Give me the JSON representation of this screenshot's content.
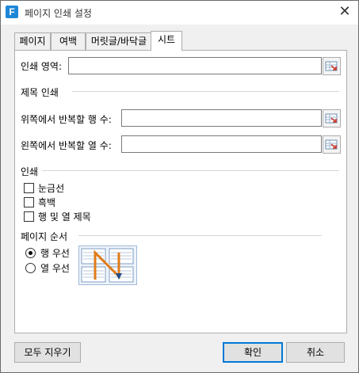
{
  "window": {
    "title": "페이지 인쇄 설정",
    "app_icon_letter": "F",
    "close_glyph": "✕"
  },
  "tabs": [
    {
      "label": "페이지",
      "active": false
    },
    {
      "label": "여백",
      "active": false
    },
    {
      "label": "머릿글/바닥글",
      "active": false
    },
    {
      "label": "시트",
      "active": true
    }
  ],
  "sheet": {
    "print_area_label": "인쇄 영역:",
    "print_area_value": "",
    "print_titles_heading": "제목 인쇄",
    "rows_repeat_label": "위쪽에서 반복할 행 수:",
    "rows_repeat_value": "",
    "cols_repeat_label": "왼쪽에서 반복할 열 수:",
    "cols_repeat_value": "",
    "print_heading": "인쇄",
    "options": [
      {
        "label": "눈금선",
        "checked": false
      },
      {
        "label": "흑백",
        "checked": false
      },
      {
        "label": "행 및 열 제목",
        "checked": false
      }
    ],
    "page_order_heading": "페이지 순서",
    "page_order": [
      {
        "label": "행 우선",
        "selected": true
      },
      {
        "label": "열 우선",
        "selected": false
      }
    ]
  },
  "buttons": {
    "clear_all": "모두 지우기",
    "ok": "확인",
    "cancel": "취소"
  },
  "colors": {
    "accent": "#0078d7",
    "app_icon": "#1f87d6",
    "order_arrow": "#e07b1a",
    "order_arrow_head": "#1f4f8a"
  }
}
